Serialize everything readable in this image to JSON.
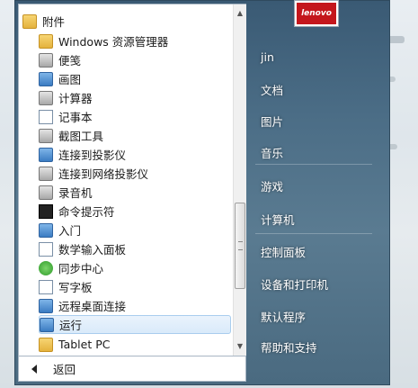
{
  "programs": [
    {
      "label": "附件",
      "icon": "folder-icon",
      "indent": 0
    },
    {
      "label": "Windows 资源管理器",
      "icon": "explorer-icon",
      "indent": 1
    },
    {
      "label": "便笺",
      "icon": "sticky-notes-icon",
      "indent": 1
    },
    {
      "label": "画图",
      "icon": "paint-icon",
      "indent": 1
    },
    {
      "label": "计算器",
      "icon": "calculator-icon",
      "indent": 1
    },
    {
      "label": "记事本",
      "icon": "notepad-icon",
      "indent": 1
    },
    {
      "label": "截图工具",
      "icon": "snipping-tool-icon",
      "indent": 1
    },
    {
      "label": "连接到投影仪",
      "icon": "projector-icon",
      "indent": 1
    },
    {
      "label": "连接到网络投影仪",
      "icon": "network-projector-icon",
      "indent": 1
    },
    {
      "label": "录音机",
      "icon": "microphone-icon",
      "indent": 1
    },
    {
      "label": "命令提示符",
      "icon": "cmd-icon",
      "indent": 1
    },
    {
      "label": "入门",
      "icon": "getting-started-icon",
      "indent": 1
    },
    {
      "label": "数学输入面板",
      "icon": "math-input-icon",
      "indent": 1
    },
    {
      "label": "同步中心",
      "icon": "sync-center-icon",
      "indent": 1
    },
    {
      "label": "写字板",
      "icon": "wordpad-icon",
      "indent": 1
    },
    {
      "label": "远程桌面连接",
      "icon": "remote-desktop-icon",
      "indent": 1
    },
    {
      "label": "运行",
      "icon": "run-icon",
      "indent": 1,
      "selected": true
    },
    {
      "label": "Tablet PC",
      "icon": "folder-icon",
      "indent": 1
    }
  ],
  "back_label": "返回",
  "avatar_text": "lenovo",
  "right_links": [
    {
      "label": "jin"
    },
    {
      "label": "文档"
    },
    {
      "label": "图片"
    },
    {
      "label": "音乐"
    },
    {
      "label": "游戏"
    },
    {
      "label": "计算机"
    },
    {
      "label": "控制面板"
    },
    {
      "label": "设备和打印机"
    },
    {
      "label": "默认程序"
    },
    {
      "label": "帮助和支持"
    }
  ],
  "colors": {
    "selection": "#d9eafa",
    "menu_frame": "#4b6d86",
    "avatar_brand": "#c4161c"
  }
}
